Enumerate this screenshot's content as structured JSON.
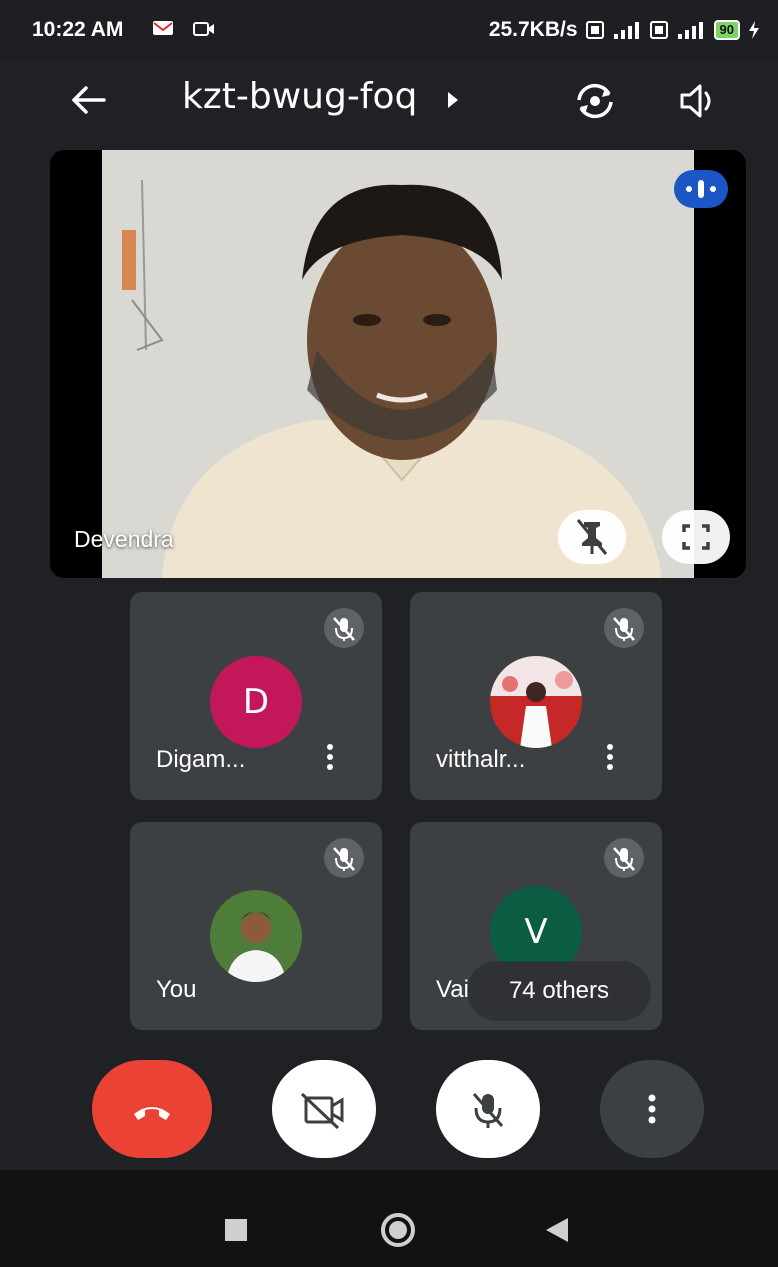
{
  "status_bar": {
    "time": "10:22 AM",
    "network_speed": "25.7KB/s",
    "battery_level": "90",
    "icons": [
      "gmail-icon",
      "video-record-icon",
      "volte-icon",
      "signal-4g-icon",
      "volte-icon",
      "signal-icon",
      "battery-icon",
      "charging-icon"
    ]
  },
  "app_bar": {
    "meeting_code": "kzt-bwug-foq",
    "icons": [
      "back-arrow-icon",
      "chevron-right-icon",
      "switch-camera-icon",
      "speaker-icon"
    ]
  },
  "main_participant": {
    "name": "Devendra",
    "icons": [
      "speaking-indicator-icon",
      "pin-icon",
      "fullscreen-icon"
    ]
  },
  "participants": [
    {
      "name": "Digam...",
      "initial": "D",
      "avatar_color": "#c2185b",
      "muted": true
    },
    {
      "name": "vitthalr...",
      "initial": "",
      "avatar_color": "#b71c1c",
      "muted": true
    },
    {
      "name": "You",
      "initial": "",
      "avatar_color": "#2e7d32",
      "muted": true
    },
    {
      "name": "Vai",
      "initial": "V",
      "avatar_color": "#0b5d43",
      "muted": true
    }
  ],
  "others_label": "74 others",
  "controls": {
    "icons": [
      "end-call-icon",
      "camera-off-icon",
      "mic-off-icon",
      "more-vert-icon"
    ]
  },
  "colors": {
    "background": "#202124",
    "tile": "#3c4043",
    "end_call": "#ea4335",
    "speaking_blue": "#1a56c4"
  }
}
